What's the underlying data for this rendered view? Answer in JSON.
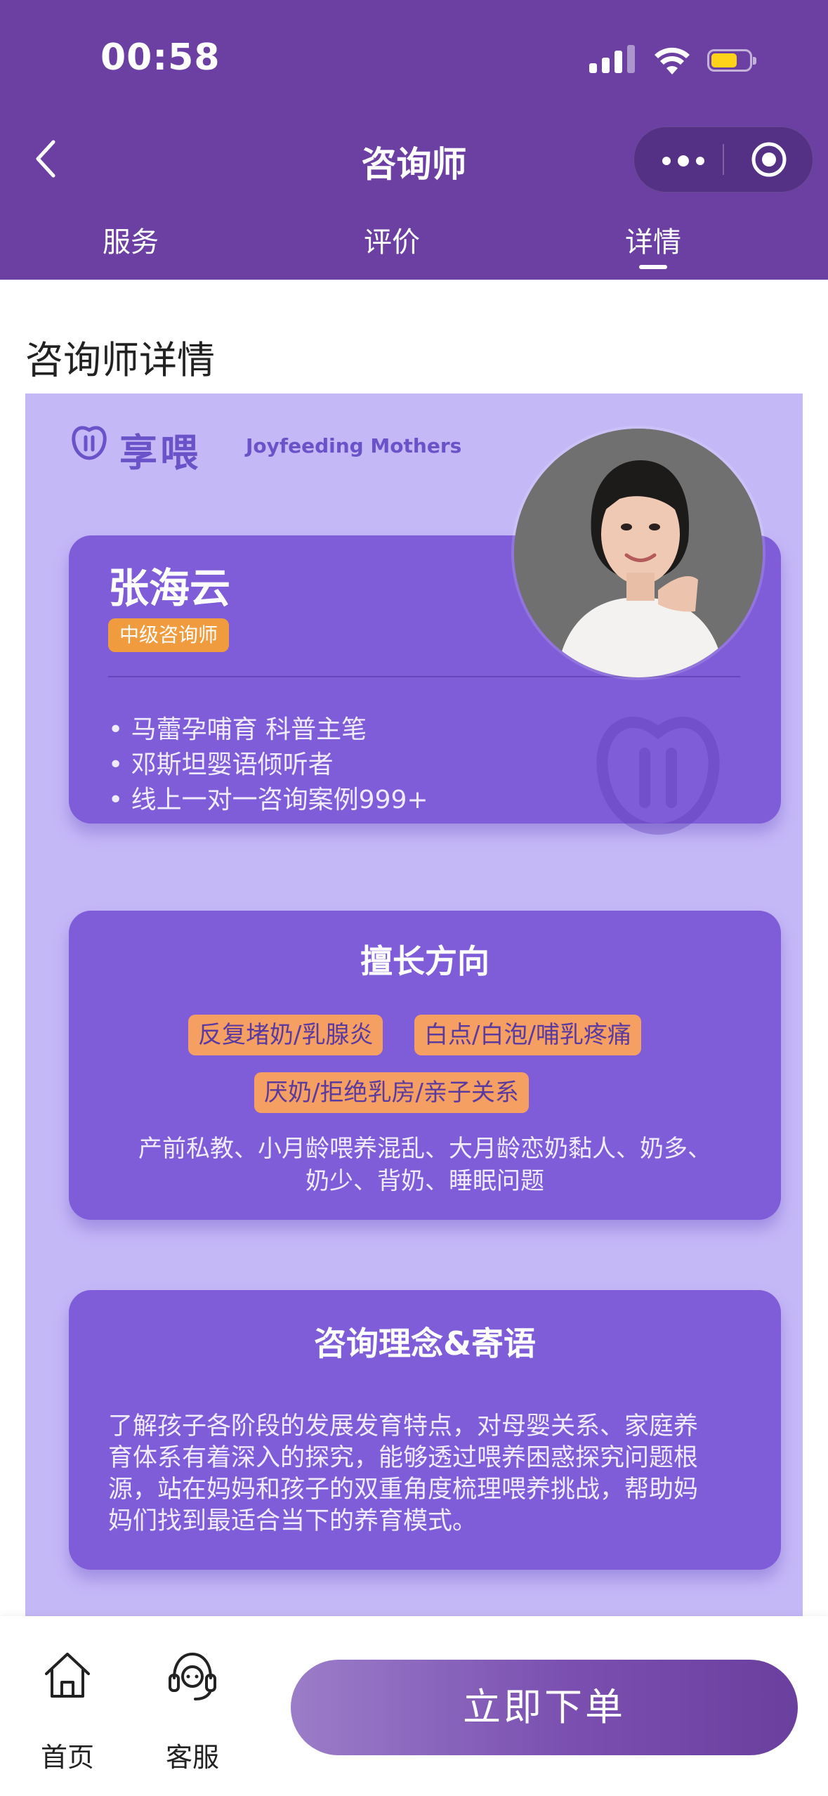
{
  "status_bar": {
    "time": "00:58"
  },
  "nav": {
    "title": "咨询师"
  },
  "tabs": [
    {
      "label": "服务"
    },
    {
      "label": "评价"
    },
    {
      "label": "详情"
    }
  ],
  "active_tab": "详情",
  "section_title": "咨询师详情",
  "brand": {
    "cn": "享喂",
    "en": "Joyfeeding Mothers"
  },
  "consultant": {
    "name": "张海云",
    "level": "中级咨询师",
    "bullets": [
      "• 马蕾孕哺育 科普主笔",
      "• 邓斯坦婴语倾听者",
      "• 线上一对一咨询案例999+"
    ]
  },
  "expertise": {
    "heading": "擅长方向",
    "tags": [
      "反复堵奶/乳腺炎",
      "白点/白泡/哺乳疼痛",
      "厌奶/拒绝乳房/亲子关系"
    ],
    "desc_lines": [
      "产前私教、小月龄喂养混乱、大月龄恋奶黏人、奶多、",
      "奶少、背奶、睡眠问题"
    ]
  },
  "philosophy": {
    "heading": "咨询理念&寄语",
    "lines": [
      "了解孩子各阶段的发展发育特点，对母婴关系、家庭养",
      "育体系有着深入的探究，能够透过喂养困惑探究问题根",
      "源，站在妈妈和孩子的双重角度梳理喂养挑战，帮助妈",
      "妈们找到最适合当下的养育模式。"
    ]
  },
  "bottom_bar": {
    "home_label": "首页",
    "service_label": "客服",
    "order_label": "立即下单"
  },
  "colors": {
    "header": "#6b40a2",
    "poster_bg": "#c5b8f7",
    "card_bg": "#7f5cd8",
    "tag_bg": "#f5a062",
    "badge_bg": "#f19b3f",
    "battery": "#ffd21a"
  }
}
